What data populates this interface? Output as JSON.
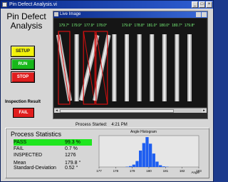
{
  "window": {
    "title": "Pin Defect Analysis.vi",
    "buttons": [
      "_",
      "□",
      "×"
    ]
  },
  "app_title": "Pin Defect Analysis",
  "controls": {
    "setup_label": "SETUP",
    "run_label": "RUN",
    "stop_label": "STOP"
  },
  "inspection": {
    "label": "Inspection Result",
    "result": "FAIL"
  },
  "image_window": {
    "title": "Live Image",
    "angle_labels": [
      "179.7°",
      "179.9°",
      "177.9°",
      "178.0°",
      "",
      "179.6°",
      "178.8°",
      "181.0°",
      "180.0°",
      "180.7°",
      "179.8°"
    ],
    "pins": [
      {
        "tilt": -10,
        "defect": true
      },
      {
        "tilt": 0,
        "defect": false
      },
      {
        "tilt": 14,
        "defect": true
      },
      {
        "tilt": 12,
        "defect": true
      },
      {
        "tilt": 0,
        "defect": false
      },
      {
        "tilt": 0,
        "defect": false
      },
      {
        "tilt": 0,
        "defect": false
      },
      {
        "tilt": 0,
        "defect": false
      },
      {
        "tilt": 0,
        "defect": false
      },
      {
        "tilt": 0,
        "defect": false
      },
      {
        "tilt": 0,
        "defect": false
      }
    ]
  },
  "process_started": {
    "label": "Process Started:",
    "time": "4:21 PM"
  },
  "stats": {
    "title": "Process Statistics",
    "pass_label": "PASS",
    "pass_value": "99.3 %",
    "fail_label": "FAIL",
    "fail_value": "0.7 %",
    "inspected_label": "INSPECTED",
    "inspected_value": "1276",
    "mean_label": "Mean",
    "mean_value": "179.8 °",
    "std_label": "Standard-Deviation",
    "std_value": "0.52 °"
  },
  "colors": {
    "setup": "#f2f20a",
    "run": "#17b81a",
    "stop": "#e01e1e",
    "pass_bg": "#1fe61f",
    "histogram": "#1e5ef0",
    "pin_label": "#7dff7d",
    "defect_box": "#d01010"
  },
  "chart_data": {
    "type": "bar",
    "title": "Angle Histogram",
    "xlabel": "Angle",
    "xlim": [
      177,
      183
    ],
    "x_ticks": [
      "177",
      "178",
      "179",
      "180",
      "181",
      "182",
      "183"
    ],
    "bin_width": 0.2,
    "x": [
      178.6,
      178.8,
      179.0,
      179.2,
      179.4,
      179.6,
      179.8,
      180.0,
      180.2,
      180.4,
      180.6,
      180.8,
      181.0
    ],
    "values": [
      1,
      3,
      8,
      20,
      55,
      80,
      100,
      78,
      45,
      18,
      6,
      2,
      1
    ],
    "ylim": [
      0,
      105
    ]
  }
}
